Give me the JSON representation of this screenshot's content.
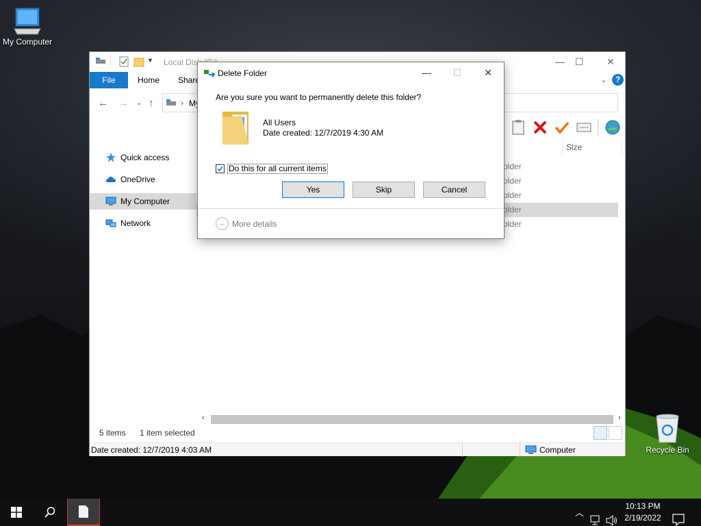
{
  "desktop": {
    "icons": [
      {
        "label": "My Computer"
      },
      {
        "label": "Recycle Bin"
      }
    ]
  },
  "explorer": {
    "title": "Local Disk (C:)",
    "ribbon_tabs": [
      "File",
      "Home",
      "Share"
    ],
    "address_text": "My",
    "column_header": "Size",
    "nav_items": [
      {
        "label": "Quick access",
        "icon": "star-icon"
      },
      {
        "label": "OneDrive",
        "icon": "cloud-icon"
      },
      {
        "label": "My Computer",
        "icon": "computer-icon"
      },
      {
        "label": "Network",
        "icon": "network-icon"
      }
    ],
    "file_rows": [
      {
        "type": "older"
      },
      {
        "type": "older"
      },
      {
        "type": "older"
      },
      {
        "type": "older"
      },
      {
        "type": "older"
      }
    ],
    "status": {
      "items": "5 items",
      "selected": "1 item selected"
    },
    "details_bar": {
      "date_created": "Date created: 12/7/2019 4:03 AM",
      "location": "Computer"
    }
  },
  "dialog": {
    "title": "Delete Folder",
    "question": "Are you sure you want to permanently delete this folder?",
    "item_name": "All Users",
    "item_date": "Date created: 12/7/2019 4:30 AM",
    "checkbox_label": "Do this for all current items",
    "checkbox_checked": true,
    "buttons": {
      "yes": "Yes",
      "skip": "Skip",
      "cancel": "Cancel"
    },
    "more_details": "More details"
  },
  "taskbar": {
    "time": "10:13 PM",
    "date": "2/19/2022"
  },
  "colors": {
    "accent": "#1979ca",
    "selection": "#d9d9d9",
    "taskbar": "#101010"
  }
}
